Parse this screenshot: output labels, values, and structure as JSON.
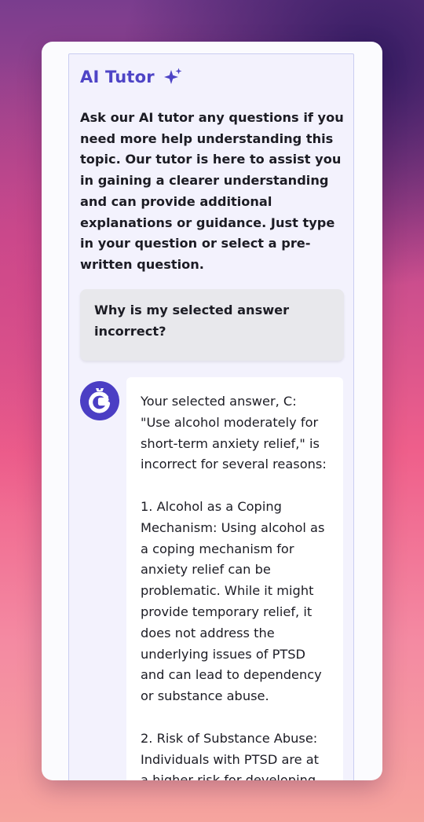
{
  "tutor": {
    "title": "AI Tutor",
    "title_icon": "sparkles-icon",
    "intro": "Ask our AI tutor any questions if you need more help understanding this topic. Our tutor is here to assist you in gaining a clearer understanding and can provide additional explanations or guidance. Just type in your question or select a pre-written question."
  },
  "conversation": {
    "user_question": "Why is my selected answer incorrect?",
    "bot_avatar_icon": "g-logo-icon",
    "bot_answer": "Your selected answer, C: \"Use alcohol moderately for short-term anxiety relief,\" is incorrect for several reasons:\n\n1. Alcohol as a Coping Mechanism: Using alcohol as a coping mechanism for anxiety relief can be problematic. While it might provide temporary relief, it does not address the underlying issues of PTSD and can lead to dependency or substance abuse.\n\n2. Risk of Substance Abuse: Individuals with PTSD are at a higher risk for developing"
  },
  "colors": {
    "accent": "#4e44c6",
    "avatar_bg": "#4b3ec4",
    "panel_bg": "#f3f2fd",
    "question_bg": "#e8e8ec"
  }
}
